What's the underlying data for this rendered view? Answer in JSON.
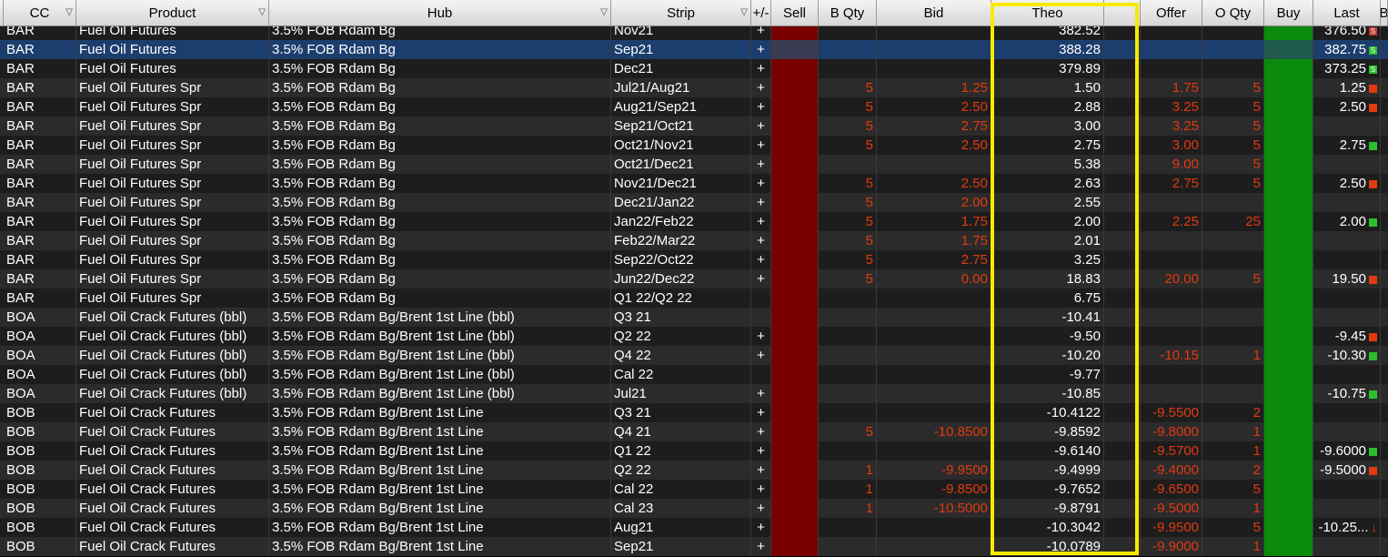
{
  "columns": [
    {
      "key": "cc",
      "label": "CC",
      "filter": true
    },
    {
      "key": "product",
      "label": "Product",
      "filter": true
    },
    {
      "key": "hub",
      "label": "Hub",
      "filter": true
    },
    {
      "key": "strip",
      "label": "Strip",
      "filter": true
    },
    {
      "key": "pm",
      "label": "+/-",
      "filter": false
    },
    {
      "key": "sell",
      "label": "Sell",
      "filter": false
    },
    {
      "key": "bqty",
      "label": "B Qty",
      "filter": false
    },
    {
      "key": "bid",
      "label": "Bid",
      "filter": false
    },
    {
      "key": "theo",
      "label": "Theo",
      "filter": false
    },
    {
      "key": "blank",
      "label": "",
      "filter": false
    },
    {
      "key": "offer",
      "label": "Offer",
      "filter": false
    },
    {
      "key": "oqty",
      "label": "O Qty",
      "filter": false
    },
    {
      "key": "buy",
      "label": "Buy",
      "filter": false
    },
    {
      "key": "last",
      "label": "Last",
      "filter": false
    },
    {
      "key": "more",
      "label": "B",
      "filter": false
    }
  ],
  "colors": {
    "sell": "#7a0000",
    "buy": "#0a8a0a",
    "highlight": "#f7ea00",
    "selected_row": "#1c3e6e",
    "negative_text": "#e23a10"
  },
  "rows": [
    {
      "cc": "BAR",
      "product": "Fuel Oil Futures",
      "hub": "3.5% FOB Rdam Bg",
      "strip": "Nov21",
      "pm": "+",
      "bqty": "",
      "bid": "",
      "theo": "382.52",
      "offer": "",
      "oqty": "",
      "last": "376.50",
      "last_mark": "s",
      "partial": true
    },
    {
      "cc": "BAR",
      "product": "Fuel Oil Futures",
      "hub": "3.5% FOB Rdam Bg",
      "strip": "Sep21",
      "pm": "+",
      "bqty": "",
      "bid": "",
      "theo": "388.28",
      "offer": "",
      "oqty": "",
      "last": "382.75",
      "last_mark": "s",
      "selected": true
    },
    {
      "cc": "BAR",
      "product": "Fuel Oil Futures",
      "hub": "3.5% FOB Rdam Bg",
      "strip": "Dec21",
      "pm": "+",
      "bqty": "",
      "bid": "",
      "theo": "379.89",
      "offer": "",
      "oqty": "",
      "last": "373.25",
      "last_mark": "s"
    },
    {
      "cc": "BAR",
      "product": "Fuel Oil Futures Spr",
      "hub": "3.5% FOB Rdam Bg",
      "strip": "Jul21/Aug21",
      "pm": "+",
      "bqty": "5",
      "bid": "1.25",
      "theo": "1.50",
      "offer": "1.75",
      "oqty": "5",
      "last": "1.25",
      "last_mark": "r"
    },
    {
      "cc": "BAR",
      "product": "Fuel Oil Futures Spr",
      "hub": "3.5% FOB Rdam Bg",
      "strip": "Aug21/Sep21",
      "pm": "+",
      "bqty": "5",
      "bid": "2.50",
      "theo": "2.88",
      "offer": "3.25",
      "oqty": "5",
      "last": "2.50",
      "last_mark": "r"
    },
    {
      "cc": "BAR",
      "product": "Fuel Oil Futures Spr",
      "hub": "3.5% FOB Rdam Bg",
      "strip": "Sep21/Oct21",
      "pm": "+",
      "bqty": "5",
      "bid": "2.75",
      "theo": "3.00",
      "offer": "3.25",
      "oqty": "5",
      "last": "",
      "last_mark": ""
    },
    {
      "cc": "BAR",
      "product": "Fuel Oil Futures Spr",
      "hub": "3.5% FOB Rdam Bg",
      "strip": "Oct21/Nov21",
      "pm": "+",
      "bqty": "5",
      "bid": "2.50",
      "theo": "2.75",
      "offer": "3.00",
      "oqty": "5",
      "last": "2.75",
      "last_mark": "g"
    },
    {
      "cc": "BAR",
      "product": "Fuel Oil Futures Spr",
      "hub": "3.5% FOB Rdam Bg",
      "strip": "Oct21/Dec21",
      "pm": "+",
      "bqty": "",
      "bid": "",
      "theo": "5.38",
      "offer": "9.00",
      "oqty": "5",
      "last": "",
      "last_mark": ""
    },
    {
      "cc": "BAR",
      "product": "Fuel Oil Futures Spr",
      "hub": "3.5% FOB Rdam Bg",
      "strip": "Nov21/Dec21",
      "pm": "+",
      "bqty": "5",
      "bid": "2.50",
      "theo": "2.63",
      "offer": "2.75",
      "oqty": "5",
      "last": "2.50",
      "last_mark": "r"
    },
    {
      "cc": "BAR",
      "product": "Fuel Oil Futures Spr",
      "hub": "3.5% FOB Rdam Bg",
      "strip": "Dec21/Jan22",
      "pm": "+",
      "bqty": "5",
      "bid": "2.00",
      "theo": "2.55",
      "offer": "",
      "oqty": "",
      "last": "",
      "last_mark": ""
    },
    {
      "cc": "BAR",
      "product": "Fuel Oil Futures Spr",
      "hub": "3.5% FOB Rdam Bg",
      "strip": "Jan22/Feb22",
      "pm": "+",
      "bqty": "5",
      "bid": "1.75",
      "theo": "2.00",
      "offer": "2.25",
      "oqty": "25",
      "last": "2.00",
      "last_mark": "g"
    },
    {
      "cc": "BAR",
      "product": "Fuel Oil Futures Spr",
      "hub": "3.5% FOB Rdam Bg",
      "strip": "Feb22/Mar22",
      "pm": "+",
      "bqty": "5",
      "bid": "1.75",
      "theo": "2.01",
      "offer": "",
      "oqty": "",
      "last": "",
      "last_mark": ""
    },
    {
      "cc": "BAR",
      "product": "Fuel Oil Futures Spr",
      "hub": "3.5% FOB Rdam Bg",
      "strip": "Sep22/Oct22",
      "pm": "+",
      "bqty": "5",
      "bid": "2.75",
      "theo": "3.25",
      "offer": "",
      "oqty": "",
      "last": "",
      "last_mark": ""
    },
    {
      "cc": "BAR",
      "product": "Fuel Oil Futures Spr",
      "hub": "3.5% FOB Rdam Bg",
      "strip": "Jun22/Dec22",
      "pm": "+",
      "bqty": "5",
      "bid": "0.00",
      "theo": "18.83",
      "offer": "20.00",
      "oqty": "5",
      "last": "19.50",
      "last_mark": "r"
    },
    {
      "cc": "BAR",
      "product": "Fuel Oil Futures Spr",
      "hub": "3.5% FOB Rdam Bg",
      "strip": "Q1 22/Q2 22",
      "pm": "",
      "bqty": "",
      "bid": "",
      "theo": "6.75",
      "offer": "",
      "oqty": "",
      "last": "",
      "last_mark": ""
    },
    {
      "cc": "BOA",
      "product": "Fuel Oil Crack Futures (bbl)",
      "hub": "3.5% FOB Rdam Bg/Brent 1st Line (bbl)",
      "strip": "Q3 21",
      "pm": "",
      "bqty": "",
      "bid": "",
      "theo": "-10.41",
      "offer": "",
      "oqty": "",
      "last": "",
      "last_mark": ""
    },
    {
      "cc": "BOA",
      "product": "Fuel Oil Crack Futures (bbl)",
      "hub": "3.5% FOB Rdam Bg/Brent 1st Line (bbl)",
      "strip": "Q2 22",
      "pm": "+",
      "bqty": "",
      "bid": "",
      "theo": "-9.50",
      "offer": "",
      "oqty": "",
      "last": "-9.45",
      "last_mark": "r"
    },
    {
      "cc": "BOA",
      "product": "Fuel Oil Crack Futures (bbl)",
      "hub": "3.5% FOB Rdam Bg/Brent 1st Line (bbl)",
      "strip": "Q4 22",
      "pm": "+",
      "bqty": "",
      "bid": "",
      "theo": "-10.20",
      "offer": "-10.15",
      "oqty": "1",
      "last": "-10.30",
      "last_mark": "g"
    },
    {
      "cc": "BOA",
      "product": "Fuel Oil Crack Futures (bbl)",
      "hub": "3.5% FOB Rdam Bg/Brent 1st Line (bbl)",
      "strip": "Cal 22",
      "pm": "",
      "bqty": "",
      "bid": "",
      "theo": "-9.77",
      "offer": "",
      "oqty": "",
      "last": "",
      "last_mark": ""
    },
    {
      "cc": "BOA",
      "product": "Fuel Oil Crack Futures (bbl)",
      "hub": "3.5% FOB Rdam Bg/Brent 1st Line (bbl)",
      "strip": "Jul21",
      "pm": "+",
      "bqty": "",
      "bid": "",
      "theo": "-10.85",
      "offer": "",
      "oqty": "",
      "last": "-10.75",
      "last_mark": "g"
    },
    {
      "cc": "BOB",
      "product": "Fuel Oil Crack Futures",
      "hub": "3.5% FOB Rdam Bg/Brent 1st Line",
      "strip": "Q3 21",
      "pm": "+",
      "bqty": "",
      "bid": "",
      "theo": "-10.4122",
      "offer": "-9.5500",
      "oqty": "2",
      "last": "",
      "last_mark": ""
    },
    {
      "cc": "BOB",
      "product": "Fuel Oil Crack Futures",
      "hub": "3.5% FOB Rdam Bg/Brent 1st Line",
      "strip": "Q4 21",
      "pm": "+",
      "bqty": "5",
      "bid": "-10.8500",
      "theo": "-9.8592",
      "offer": "-9.8000",
      "oqty": "1",
      "last": "",
      "last_mark": ""
    },
    {
      "cc": "BOB",
      "product": "Fuel Oil Crack Futures",
      "hub": "3.5% FOB Rdam Bg/Brent 1st Line",
      "strip": "Q1 22",
      "pm": "+",
      "bqty": "",
      "bid": "",
      "theo": "-9.6140",
      "offer": "-9.5700",
      "oqty": "1",
      "last": "-9.6000",
      "last_mark": "g"
    },
    {
      "cc": "BOB",
      "product": "Fuel Oil Crack Futures",
      "hub": "3.5% FOB Rdam Bg/Brent 1st Line",
      "strip": "Q2 22",
      "pm": "+",
      "bqty": "1",
      "bid": "-9.9500",
      "theo": "-9.4999",
      "offer": "-9.4000",
      "oqty": "2",
      "last": "-9.5000",
      "last_mark": "r"
    },
    {
      "cc": "BOB",
      "product": "Fuel Oil Crack Futures",
      "hub": "3.5% FOB Rdam Bg/Brent 1st Line",
      "strip": "Cal 22",
      "pm": "+",
      "bqty": "1",
      "bid": "-9.8500",
      "theo": "-9.7652",
      "offer": "-9.6500",
      "oqty": "5",
      "last": "",
      "last_mark": ""
    },
    {
      "cc": "BOB",
      "product": "Fuel Oil Crack Futures",
      "hub": "3.5% FOB Rdam Bg/Brent 1st Line",
      "strip": "Cal 23",
      "pm": "+",
      "bqty": "1",
      "bid": "-10.5000",
      "theo": "-9.8791",
      "offer": "-9.5000",
      "oqty": "1",
      "last": "",
      "last_mark": ""
    },
    {
      "cc": "BOB",
      "product": "Fuel Oil Crack Futures",
      "hub": "3.5% FOB Rdam Bg/Brent 1st Line",
      "strip": "Aug21",
      "pm": "+",
      "bqty": "",
      "bid": "",
      "theo": "-10.3042",
      "offer": "-9.9500",
      "oqty": "5",
      "last": "-10.25...",
      "last_mark": "arrow"
    },
    {
      "cc": "BOB",
      "product": "Fuel Oil Crack Futures",
      "hub": "3.5% FOB Rdam Bg/Brent 1st Line",
      "strip": "Sep21",
      "pm": "+",
      "bqty": "",
      "bid": "",
      "theo": "-10.0789",
      "offer": "-9.9000",
      "oqty": "1",
      "last": "",
      "last_mark": ""
    }
  ]
}
